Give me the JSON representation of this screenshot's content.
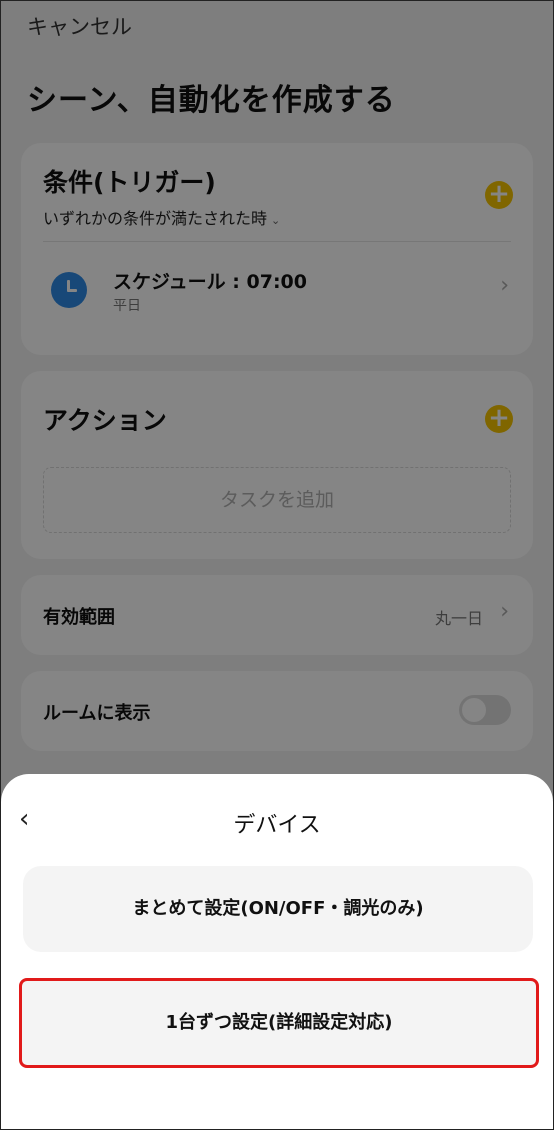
{
  "header": {
    "cancel_label": "キャンセル",
    "page_title": "シーン、自動化を作成する"
  },
  "trigger": {
    "title": "条件(トリガー)",
    "condition_mode": "いずれかの条件が満たされた時",
    "schedule_title": "スケジュール : 07:00",
    "schedule_days": "平日"
  },
  "action": {
    "title": "アクション",
    "add_task_label": "タスクを追加"
  },
  "scope": {
    "label": "有効範囲",
    "value": "丸一日"
  },
  "room": {
    "label": "ルームに表示",
    "toggle_on": false
  },
  "sheet": {
    "title": "デバイス",
    "option1_label": "まとめて設定(ON/OFF・調光のみ)",
    "option2_label": "1台ずつ設定(詳細設定対応)"
  },
  "colors": {
    "accent": "#f5c400",
    "clock_icon": "#2e8be6",
    "highlight": "#e11a1a"
  },
  "icons": {
    "plus": "+",
    "chevron_right": "›",
    "chevron_down": "⌄",
    "back": "‹"
  }
}
